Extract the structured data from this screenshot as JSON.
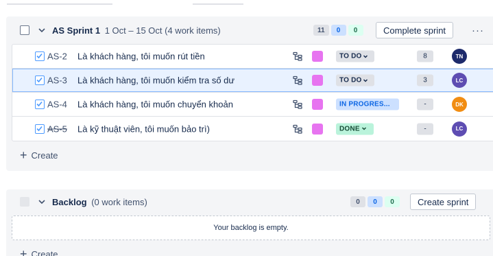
{
  "sprint": {
    "name": "AS Sprint 1",
    "dates": "1 Oct – 15 Oct (4 work items)",
    "counts": {
      "todo": "11",
      "in_progress": "0",
      "done": "0"
    },
    "complete_label": "Complete sprint",
    "more_label": "···",
    "create_label": "Create",
    "items": [
      {
        "key": "AS-2",
        "summary": "Là khách hàng, tôi muốn rút tiền",
        "status": "TO DO",
        "status_type": "todo",
        "estimate": "8",
        "assignee": "TN",
        "assignee_color": "#1d2a6b",
        "done": false
      },
      {
        "key": "AS-3",
        "summary": "Là khách hàng, tôi muốn kiểm tra số dư",
        "status": "TO DO",
        "status_type": "todo",
        "estimate": "3",
        "assignee": "LC",
        "assignee_color": "#5e4db2",
        "done": false
      },
      {
        "key": "AS-4",
        "summary": "Là khách hàng, tôi muốn chuyển khoản",
        "status": "IN PROGRES...",
        "status_type": "prog",
        "estimate": "-",
        "assignee": "DK",
        "assignee_color": "#f18d13",
        "done": false
      },
      {
        "key": "AS-5",
        "summary": "Là kỹ thuật viên, tôi muốn bảo trì)",
        "status": "DONE",
        "status_type": "done",
        "estimate": "-",
        "assignee": "LC",
        "assignee_color": "#5e4db2",
        "done": true
      }
    ]
  },
  "backlog": {
    "name": "Backlog",
    "meta": "(0 work items)",
    "counts": {
      "todo": "0",
      "in_progress": "0",
      "done": "0"
    },
    "create_sprint_label": "Create sprint",
    "empty_text": "Your backlog is empty.",
    "create_label": "Create"
  },
  "colors": {
    "epic": "#e774f0",
    "story_check": "#4c9aff",
    "selected_row": "#e9f2ff"
  }
}
